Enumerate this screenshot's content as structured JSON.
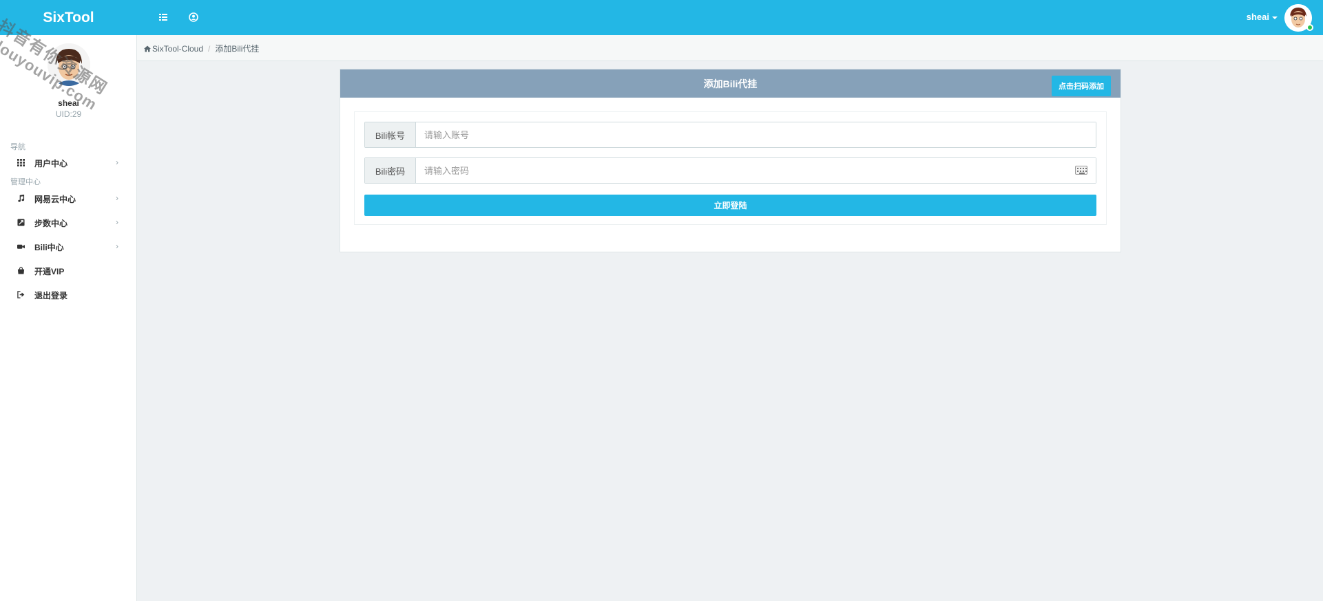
{
  "app": {
    "brand": "SixTool"
  },
  "topbar": {
    "username": "sheai",
    "icons": [
      "list-icon",
      "user-circle-icon"
    ]
  },
  "sidebar": {
    "user": {
      "name": "sheai",
      "uid": "UID:29"
    },
    "sections": {
      "nav": "导航",
      "admin": "管理中心"
    },
    "items": [
      {
        "label": "用户中心",
        "icon": "grid-icon",
        "chevron": "›"
      },
      {
        "label": "网易云中心",
        "icon": "music-icon",
        "chevron": "›"
      },
      {
        "label": "步数中心",
        "icon": "steps-icon",
        "chevron": "›"
      },
      {
        "label": "Bili中心",
        "icon": "video-camera-icon",
        "chevron": "›"
      },
      {
        "label": "开通VIP",
        "icon": "shopping-bag-icon"
      },
      {
        "label": "退出登录",
        "icon": "sign-out-icon"
      }
    ]
  },
  "breadcrumb": {
    "home": "SixTool-Cloud",
    "separator": "/",
    "current": "添加Bili代挂"
  },
  "panel": {
    "title": "添加Bili代挂",
    "qr_button": "点击扫码添加",
    "account": {
      "label": "Bili帐号",
      "placeholder": "请输入账号",
      "value": ""
    },
    "password": {
      "label": "Bili密码",
      "placeholder": "请输入密码",
      "value": ""
    },
    "submit": "立即登陆"
  },
  "watermark": {
    "line1": "抖音有你资源网",
    "line2": "douyouvip.com"
  },
  "colors": {
    "primary": "#23b7e5",
    "panel_header": "#86a1b9",
    "background": "#eef1f3",
    "online": "#27c24c"
  }
}
